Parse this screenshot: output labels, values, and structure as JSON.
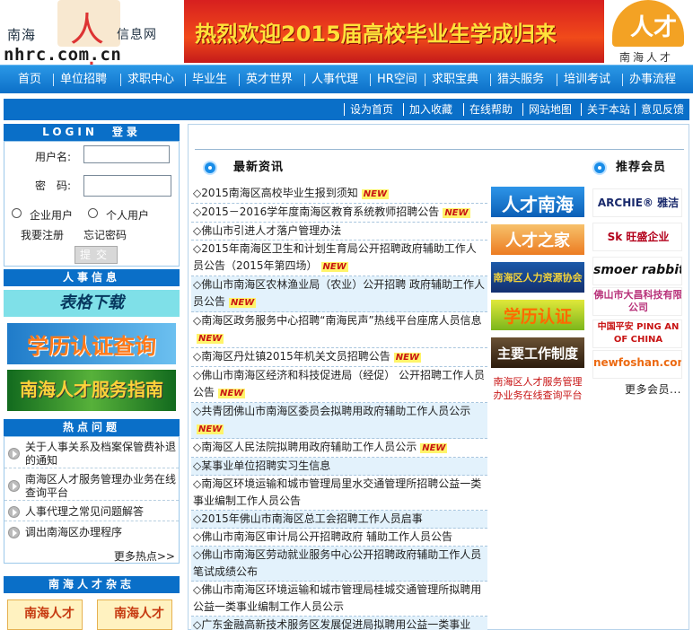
{
  "header": {
    "logo_left": "南海",
    "logo_right": "信息网",
    "logo_char": "人才",
    "domain": "nhrc.com.cn",
    "banner_text": "热烈欢迎2015届高校毕业生学成归来",
    "right_logo_label": "南海人才",
    "right_logo_char": "人才"
  },
  "nav": [
    "首页",
    "单位招聘",
    "求职中心",
    "毕业生",
    "英才世界",
    "人事代理",
    "HR空间",
    "求职宝典",
    "猎头服务",
    "培训考试",
    "办事流程"
  ],
  "subnav": [
    "设为首页",
    "加入收藏",
    "在线帮助",
    "网站地图",
    "关于本站",
    "意见反馈"
  ],
  "login": {
    "title": "LOGIN　登录",
    "username_label": "用户名:",
    "password_label": "密　码:",
    "radio_company": "企业用户",
    "radio_personal": "个人用户",
    "register": "我要注册",
    "forgot": "忘记密码",
    "submit": "提交"
  },
  "hr_info": {
    "title": "人事信息",
    "form_download": "表格下载",
    "promo1": "学历认证查询",
    "promo2": "南海人才服务指南"
  },
  "hot": {
    "title": "热点问题",
    "items": [
      "关于人事关系及档案保管费补退的通知",
      "南海区人才服务管理办业务在线查询平台",
      "人事代理之常见问题解答",
      "调出南海区办理程序"
    ],
    "more": "更多热点>>"
  },
  "magazine": {
    "title": "南海人才杂志",
    "item1": "南海人才",
    "item2": "南海人才"
  },
  "news": {
    "title": "最新资讯",
    "new_badge": "NEW",
    "items": [
      {
        "text": "◇2015南海区高校毕业生报到须知",
        "new": true,
        "alt": false
      },
      {
        "text": "◇2015－2016学年度南海区教育系统教师招聘公告",
        "new": true,
        "alt": false
      },
      {
        "text": "◇佛山市引进人才落户管理办法",
        "new": false,
        "alt": false
      },
      {
        "text": "◇2015年南海区卫生和计划生育局公开招聘政府辅助工作人员公告（2015年第四场）",
        "new": true,
        "alt": false
      },
      {
        "text": "◇佛山市南海区农林渔业局（农业）公开招聘 政府辅助工作人员公告",
        "new": true,
        "alt": true
      },
      {
        "text": "◇南海区政务服务中心招聘“南海民声”热线平台座席人员信息",
        "new": true,
        "alt": false
      },
      {
        "text": "◇南海区丹灶镇2015年机关文员招聘公告",
        "new": true,
        "alt": false
      },
      {
        "text": "◇佛山市南海区经济和科技促进局（经促） 公开招聘工作人员公告",
        "new": true,
        "alt": false
      },
      {
        "text": "◇共青团佛山市南海区委员会拟聘用政府辅助工作人员公示",
        "new": true,
        "alt": true
      },
      {
        "text": "◇南海区人民法院拟聘用政府辅助工作人员公示",
        "new": true,
        "alt": false
      },
      {
        "text": "◇某事业单位招聘实习生信息",
        "new": false,
        "alt": true
      },
      {
        "text": "◇南海区环境运输和城市管理局里水交通管理所招聘公益一类事业编制工作人员公告",
        "new": false,
        "alt": false
      },
      {
        "text": "◇2015年佛山市南海区总工会招聘工作人员启事",
        "new": false,
        "alt": true
      },
      {
        "text": "◇佛山市南海区审计局公开招聘政府 辅助工作人员公告",
        "new": false,
        "alt": false
      },
      {
        "text": "◇佛山市南海区劳动就业服务中心公开招聘政府辅助工作人员笔试成绩公布",
        "new": false,
        "alt": true
      },
      {
        "text": "◇佛山市南海区环境运输和城市管理局桂城交通管理所拟聘用公益一类事业编制工作人员公示",
        "new": false,
        "alt": false
      },
      {
        "text": "◇广东金融高新技术服务区发展促进局拟聘用公益一类事业",
        "new": false,
        "alt": true
      }
    ]
  },
  "quick_links": {
    "items": [
      "人才南海",
      "人才之家",
      "南海区人力资源协会",
      "学历认证",
      "主要工作制度"
    ],
    "note": "南海区人才服务管理办业务在线查询平台"
  },
  "members": {
    "title": "推荐会员",
    "items": [
      "ARCHIE® 雅洁",
      "Sk 旺盛企业",
      "smoer rabbit",
      "佛山市大昌科技有限公司",
      "中国平安 PING AN OF CHINA",
      "newfoshan.com"
    ],
    "more": "更多会员..."
  },
  "colors": {
    "nav_blue": "#0c6fc8",
    "banner_red": "#d71f1f",
    "banner_text": "#ffe23a",
    "new_red": "#c81414"
  }
}
